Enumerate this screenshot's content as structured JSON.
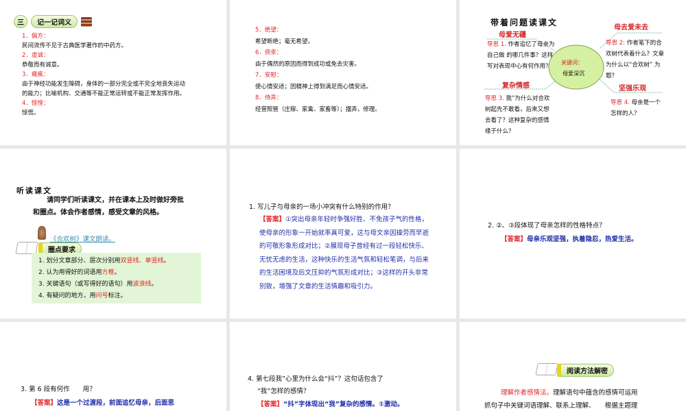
{
  "slide1": {
    "num": "三",
    "title": "记一记词义",
    "items": [
      {
        "term": "1．偏方：",
        "def": "民间流传不见于古典医学著作的中药方。"
      },
      {
        "term": "2．虔诚：",
        "def": "恭敬而有诚意。"
      },
      {
        "term": "3．瘫痪：",
        "def": "由于神经功能发生障碍，身体的一部分完全或不完全地丧失运动"
      },
      {
        "term": "4．惊惶：",
        "def": "惊慌。"
      }
    ],
    "def3_line2": "的能力；比喻机构、交通等不能正常运转或不能正常发挥作用。"
  },
  "slide2": {
    "items": [
      {
        "term": "5．绝望：",
        "def": "希望断绝；毫无希望。"
      },
      {
        "term": "6．侥幸：",
        "def": "由于偶然的原因而得到成功或免去灾害。"
      },
      {
        "term": "7．安慰：",
        "def": "使心情安适；因精神上得到满足而心情安适。"
      },
      {
        "term": "8．侍弄：",
        "def": "经营照管（庄稼、家禽、家畜等）；摆弄，修理。"
      }
    ]
  },
  "slide3": {
    "title": "带着问题读课文",
    "center_label": "关键词：",
    "center_value": "母爱深沉",
    "branches": [
      {
        "heading": "母爱无疆",
        "tag": "导思 1.",
        "text": "作者追忆了母亲为自己做 的哪几件事？这样写对表现中心有何作用？"
      },
      {
        "heading": "母去爱未去",
        "tag": "导思 2:",
        "text": "作者笔下的合欢树代表着什么？文章为什么以“合欢树” 为题？"
      },
      {
        "heading": "复杂情感",
        "tag": "导思 3.",
        "text": "我”为什么对合欢树起先不敢看，后来又想去看了？这种复杂的感情缘于什么？"
      },
      {
        "heading": "坚强乐观",
        "tag": "导思 4.",
        "text": "母亲是一个怎样的人？"
      }
    ]
  },
  "slide4": {
    "title": "听读课文",
    "intro_line1": "请同学们听读课文，并在课本上及时做好旁批",
    "intro_line2": "和圈点。体会作者感情，感受文章的风格。",
    "audio_link": "《合欢树》课文朗读。",
    "section": "圈点要求",
    "reqs": [
      {
        "pre": "1. 划分文章部分、层次分别用",
        "hl": "双竖线、单竖线",
        "post": "。"
      },
      {
        "pre": "2. 认为用得好的词语用",
        "hl": "方框",
        "post": "。"
      },
      {
        "pre": "3. 关键语句（或写得好的语句）用",
        "hl": "波浪线",
        "post": "。"
      },
      {
        "pre": "4. 有疑问的地方，用",
        "hl": "问号",
        "post": "标注。"
      }
    ]
  },
  "slide5": {
    "question": "1.  写儿子与母亲的一场小冲突有什么特别的作用？",
    "answer_tag": "【答案】",
    "answer": "①突出母亲年轻时争强好胜、不免孩子气的性格，使母亲的形象一开始就率真可爱，这与母文亲因操劳而早逝的可敬形象形成对比；②展现母子曾经有过一段轻松快乐、无忧无虑的生活，这种快乐的生活气氛和轻松笔调，与后来的生活困境及后文压抑的气氛形成对比；③这样的开头非常别致，增强了文章的生活情趣和吸引力。"
  },
  "slide6": {
    "question": "2. ②、③段体现了母亲怎样的性格特点？",
    "answer_tag": "【答案】",
    "answer": "母亲乐观坚强，执着隐忍，热爱生活。"
  },
  "slide7": {
    "question": "3. 第 6 段有何作　　用？",
    "answer_tag": "【答案】",
    "answer": "这是一个过渡段，前面追忆母亲，后面思"
  },
  "slide8": {
    "question_line1": "4. 第七段我”心里为什么会“抖”？这句话包含了",
    "question_line2": "“我”怎样的感情？",
    "answer_tag": "【答案】",
    "answer": "“抖”字体现出“我”复杂的感情。①激动。"
  },
  "slide9": {
    "section": "阅读方法解密",
    "method": "理解作者感情法。",
    "line1": "理解语句中蕴含的感情可运用",
    "line2": "抓句子中关键词语理解、联系上理解、　　根据主题理"
  }
}
